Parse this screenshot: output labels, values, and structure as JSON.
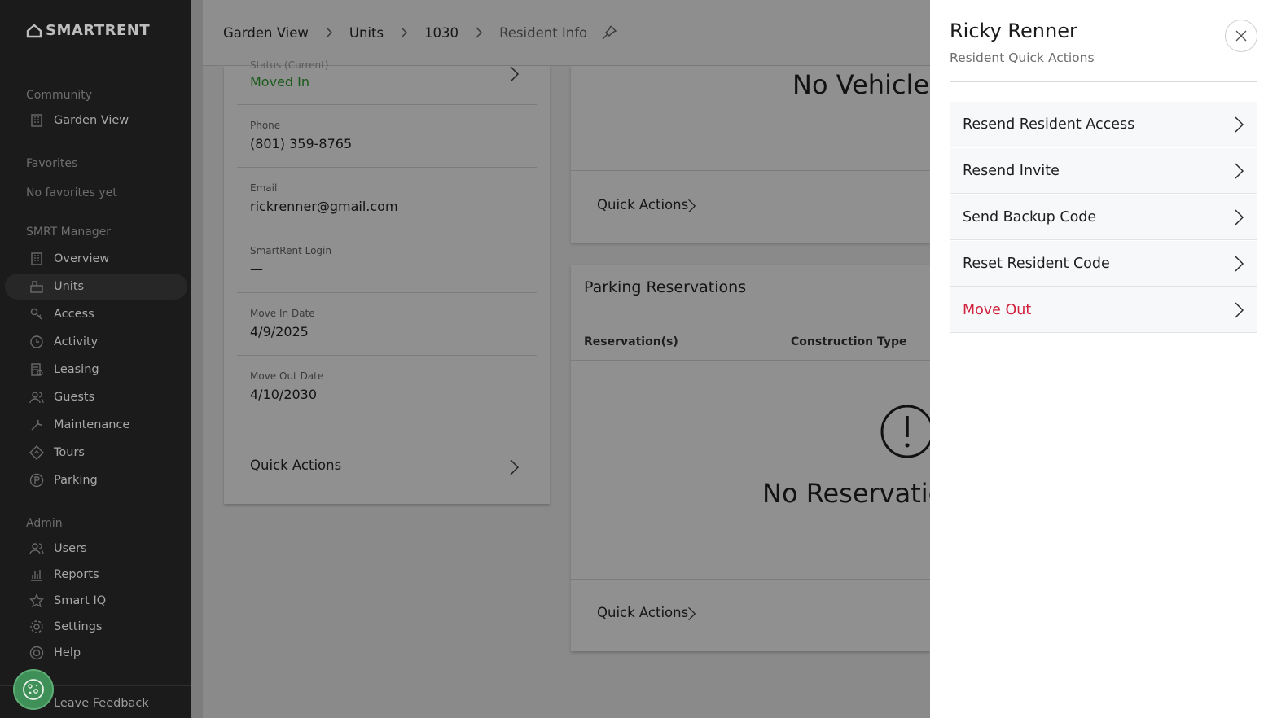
{
  "sidebar": {
    "logo": "SMARTRENT",
    "community_label": "Community",
    "community_item": "Garden View",
    "favorites_label": "Favorites",
    "favorites_empty": "No favorites yet",
    "manager_label": "SMRT Manager",
    "manager_items": [
      {
        "label": "Overview",
        "icon": "building-icon"
      },
      {
        "label": "Units",
        "icon": "units-icon",
        "active": true
      },
      {
        "label": "Access",
        "icon": "key-icon"
      },
      {
        "label": "Activity",
        "icon": "clock-icon"
      },
      {
        "label": "Leasing",
        "icon": "leasing-icon"
      },
      {
        "label": "Guests",
        "icon": "guests-icon"
      },
      {
        "label": "Maintenance",
        "icon": "wrench-icon"
      },
      {
        "label": "Tours",
        "icon": "tours-icon"
      },
      {
        "label": "Parking",
        "icon": "parking-icon"
      }
    ],
    "admin_label": "Admin",
    "admin_items": [
      {
        "label": "Users",
        "icon": "users-icon"
      },
      {
        "label": "Reports",
        "icon": "reports-icon"
      },
      {
        "label": "Smart IQ",
        "icon": "star-icon"
      },
      {
        "label": "Settings",
        "icon": "gear-icon"
      },
      {
        "label": "Help",
        "icon": "help-icon"
      }
    ],
    "feedback": "Leave Feedback"
  },
  "breadcrumb": [
    "Garden View",
    "Units",
    "1030",
    "Resident Info"
  ],
  "resident_card": {
    "status_label": "Status (Current)",
    "status_value": "Moved In",
    "phone_label": "Phone",
    "phone_value": "(801) 359-8765",
    "email_label": "Email",
    "email_value": "rickrenner@gmail.com",
    "login_label": "SmartRent Login",
    "login_value": "—",
    "move_in_label": "Move In Date",
    "move_in_value": "4/9/2025",
    "move_out_label": "Move Out Date",
    "move_out_value": "4/10/2030",
    "quick_actions": "Quick Actions"
  },
  "vehicles_card": {
    "empty_text": "No Vehicles",
    "quick_actions": "Quick Actions"
  },
  "parking_card": {
    "title": "Parking Reservations",
    "col_reservations": "Reservation(s)",
    "col_construction": "Construction Type",
    "empty_text": "No Reservations",
    "quick_actions": "Quick Actions"
  },
  "drawer": {
    "title": "Ricky Renner",
    "subtitle": "Resident Quick Actions",
    "actions": [
      {
        "label": "Resend Resident Access"
      },
      {
        "label": "Resend Invite"
      },
      {
        "label": "Send Backup Code"
      },
      {
        "label": "Reset Resident Code"
      },
      {
        "label": "Move Out",
        "danger": true
      }
    ],
    "danger_color": "#d0213d"
  }
}
